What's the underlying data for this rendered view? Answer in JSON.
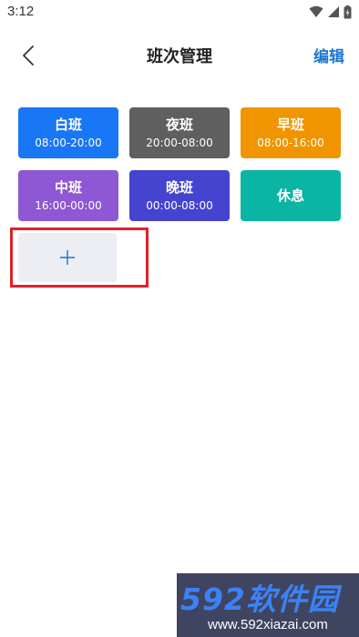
{
  "status_bar": {
    "time": "3:12"
  },
  "header": {
    "title": "班次管理",
    "edit_label": "编辑"
  },
  "shifts": [
    {
      "name": "白班",
      "time": "08:00-20:00",
      "color": "#1976f5"
    },
    {
      "name": "夜班",
      "time": "20:00-08:00",
      "color": "#5f5f5f"
    },
    {
      "name": "早班",
      "time": "08:00-16:00",
      "color": "#f09500"
    },
    {
      "name": "中班",
      "time": "16:00-00:00",
      "color": "#8e57d4"
    },
    {
      "name": "晚班",
      "time": "00:00-08:00",
      "color": "#4544d0"
    },
    {
      "name": "休息",
      "time": "",
      "color": "#0ab5a3"
    }
  ],
  "add_button": {
    "icon": "plus-icon"
  },
  "watermark": {
    "logo_text": "592软件园",
    "url": "www.592xiazai.com"
  },
  "colors": {
    "accent": "#1976d2",
    "highlight": "#e0202a",
    "add_bg": "#eceef3"
  }
}
